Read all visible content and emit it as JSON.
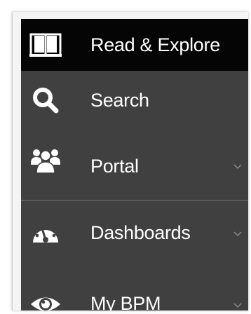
{
  "menu": {
    "items": [
      {
        "label": "Read & Explore",
        "icon": "book-icon",
        "active": true,
        "expandable": false
      },
      {
        "label": "Search",
        "icon": "search-icon",
        "active": false,
        "expandable": false
      },
      {
        "label": "Portal",
        "icon": "users-icon",
        "active": false,
        "expandable": true
      },
      {
        "label": "Dashboards",
        "icon": "gauge-icon",
        "active": false,
        "expandable": true
      },
      {
        "label": "My BPM",
        "icon": "eye-icon",
        "active": false,
        "expandable": true
      }
    ]
  },
  "colors": {
    "menu_bg": "#404040",
    "active_bg": "#050505",
    "text": "#ffffff",
    "chevron": "#8a8a8a"
  }
}
